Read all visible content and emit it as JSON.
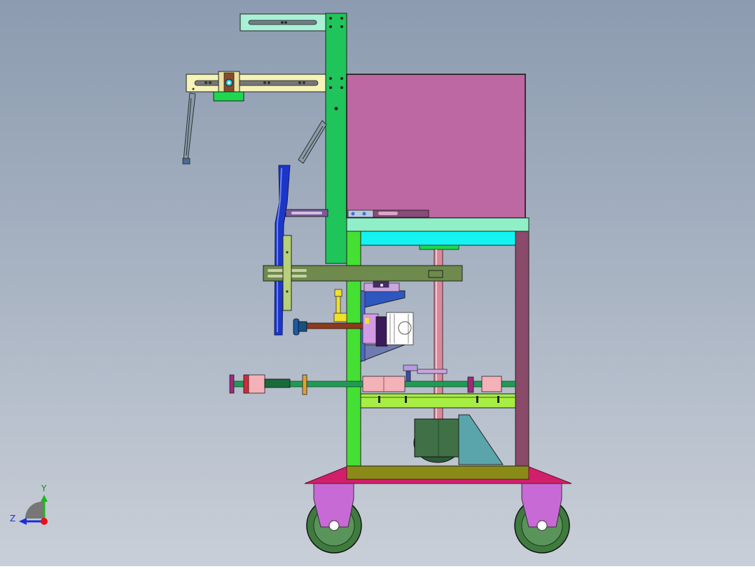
{
  "viewport": {
    "background_top": "#8c9bb0",
    "background_bottom": "#c9cfd8"
  },
  "triad": {
    "y_label": "Y",
    "z_label": "Z",
    "y_color": "#1fb61f",
    "z_color": "#1a2fd6",
    "x_color": "#e8101a"
  },
  "model": {
    "colors": {
      "cabinet": "#bd68a2",
      "upright": "#1fc45a",
      "frame_post": "#44e033",
      "frame_post_right": "#8a4a6a",
      "top_plate": "#8ff0c8",
      "cyan_bar": "#14f2f2",
      "base_plate": "#d21f6b",
      "base_beam": "#8a8a18",
      "wheel_bracket": "#c76ad6",
      "wheel": "#3f7a3f",
      "motor": "#3f7046",
      "gusset": "#5aa5ab",
      "shaft": "#d78a9a",
      "rail": "#229a55",
      "arm_top": "#a8f0d6",
      "arm_mid": "#f6f3b8",
      "blue_arm": "#1c36c8",
      "olive_bar": "#6e8a4c",
      "lime_tray": "#a6ee44"
    }
  }
}
